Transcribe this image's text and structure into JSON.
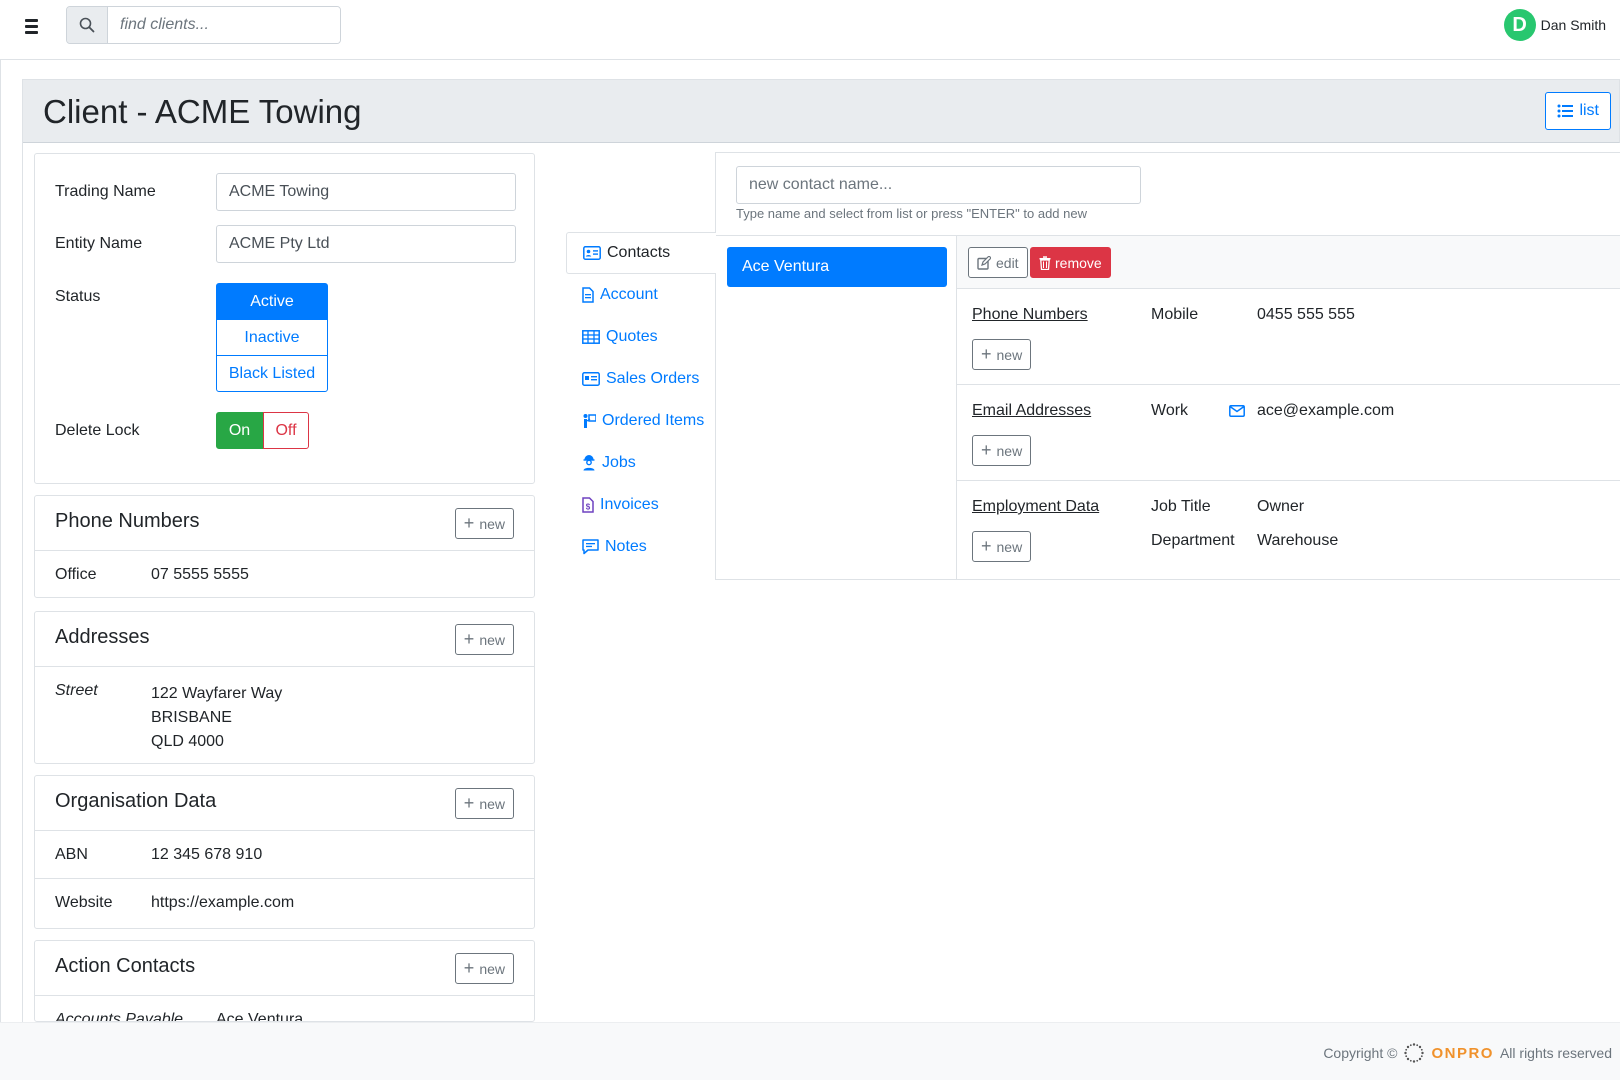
{
  "topbar": {
    "search_placeholder": "find clients...",
    "user_initial": "D",
    "user_name": "Dan Smith"
  },
  "page": {
    "title": "Client - ACME Towing",
    "list_button": "list"
  },
  "client_form": {
    "trading_name_label": "Trading Name",
    "trading_name_value": "ACME Towing",
    "entity_name_label": "Entity Name",
    "entity_name_value": "ACME Pty Ltd",
    "status_label": "Status",
    "status_options": [
      "Active",
      "Inactive",
      "Black Listed"
    ],
    "status_selected": "Active",
    "delete_lock_label": "Delete Lock",
    "delete_lock_on": "On",
    "delete_lock_off": "Off"
  },
  "phone_numbers": {
    "title": "Phone Numbers",
    "new_label": "new",
    "rows": [
      {
        "label": "Office",
        "value": "07 5555 5555"
      }
    ]
  },
  "addresses": {
    "title": "Addresses",
    "new_label": "new",
    "label": "Street",
    "line1": "122 Wayfarer Way",
    "line2": "BRISBANE",
    "line3": "QLD 4000"
  },
  "organisation_data": {
    "title": "Organisation Data",
    "new_label": "new",
    "rows": [
      {
        "label": "ABN",
        "value": "12 345 678 910"
      },
      {
        "label": "Website",
        "value": "https://example.com"
      }
    ]
  },
  "action_contacts": {
    "title": "Action Contacts",
    "new_label": "new",
    "rows": [
      {
        "label": "Accounts Payable",
        "value": "Ace Ventura"
      }
    ]
  },
  "nav": {
    "items": [
      "Contacts",
      "Account",
      "Quotes",
      "Sales Orders",
      "Ordered Items",
      "Jobs",
      "Invoices",
      "Notes"
    ],
    "active": "Contacts",
    "icons": [
      "contact-card-icon",
      "file-icon",
      "grid-table-icon",
      "order-card-icon",
      "person-board-icon",
      "worker-icon",
      "invoice-file-icon",
      "comment-icon"
    ]
  },
  "contacts": {
    "new_placeholder": "new contact name...",
    "help_text": "Type name and select from list or press \"ENTER\" to add new",
    "list": [
      "Ace Ventura"
    ],
    "edit_label": "edit",
    "remove_label": "remove",
    "phone_section": {
      "title": "Phone Numbers",
      "new_label": "new",
      "key": "Mobile",
      "value": "0455 555 555"
    },
    "email_section": {
      "title": "Email Addresses",
      "new_label": "new",
      "key": "Work",
      "value": "ace@example.com"
    },
    "employment_section": {
      "title": "Employment Data",
      "new_label": "new",
      "rows": [
        {
          "key": "Job Title",
          "value": "Owner"
        },
        {
          "key": "Department",
          "value": "Warehouse"
        }
      ]
    }
  },
  "footer": {
    "copyright": "Copyright ©",
    "brand": "ONPRO",
    "rights": "All rights reserved"
  },
  "colors": {
    "primary": "#007bff",
    "success": "#28a745",
    "danger": "#dc3545",
    "avatar": "#28c76f",
    "brand": "#f0922c"
  }
}
